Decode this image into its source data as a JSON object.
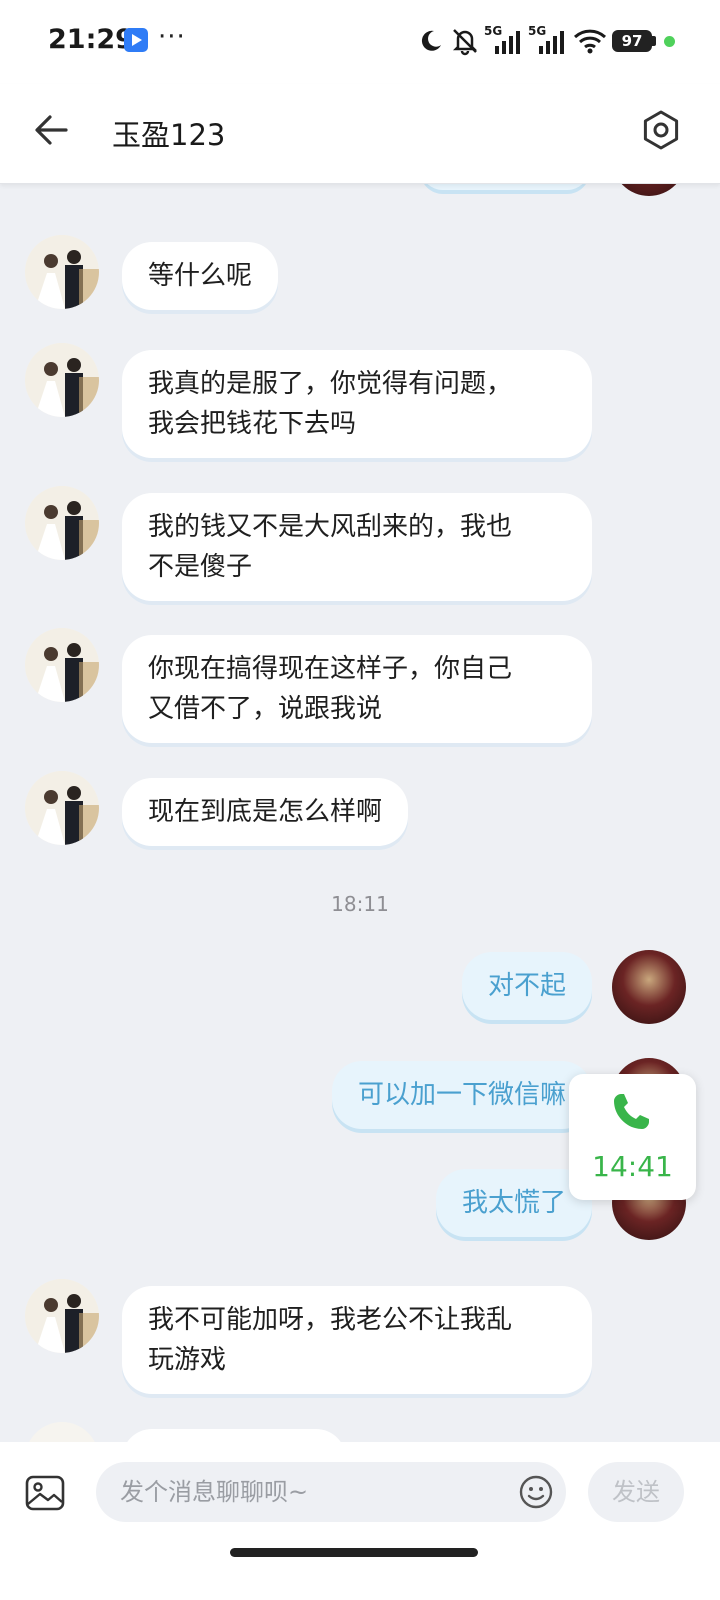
{
  "status_bar": {
    "time": "21:29",
    "dots": "···",
    "network_1": "5G",
    "network_2": "5G",
    "battery": "97"
  },
  "header": {
    "title": "玉盈123",
    "back_icon": "arrow-left-icon",
    "settings_icon": "settings-hexagon-icon"
  },
  "messages": [
    {
      "side": "in",
      "text": "等什么呢"
    },
    {
      "side": "in",
      "text": "我真的是服了，你觉得有问题，\n我会把钱花下去吗"
    },
    {
      "side": "in",
      "text": "我的钱又不是大风刮来的，我也\n不是傻子"
    },
    {
      "side": "in",
      "text": "你现在搞得现在这样子，你自己\n又借不了，说跟我说"
    },
    {
      "side": "in",
      "text": "现在到底是怎么样啊"
    },
    {
      "side": "divider",
      "text": "18:11"
    },
    {
      "side": "out",
      "text": "对不起"
    },
    {
      "side": "out",
      "text": "可以加一下微信嘛"
    },
    {
      "side": "out",
      "text": "我太慌了"
    },
    {
      "side": "in",
      "text": "我不可能加呀，我老公不让我乱\n玩游戏"
    }
  ],
  "call_widget": {
    "icon": "phone-icon",
    "duration": "14:41",
    "color": "#39b54a"
  },
  "input_bar": {
    "placeholder": "发个消息聊聊呗~",
    "send_label": "发送",
    "image_icon": "image-icon",
    "emoji_icon": "emoji-icon"
  },
  "colors": {
    "background": "#eef0f4",
    "incoming_bubble": "#ffffff",
    "outgoing_bubble": "#e7f4fc",
    "outgoing_text": "#4aa0cf"
  }
}
